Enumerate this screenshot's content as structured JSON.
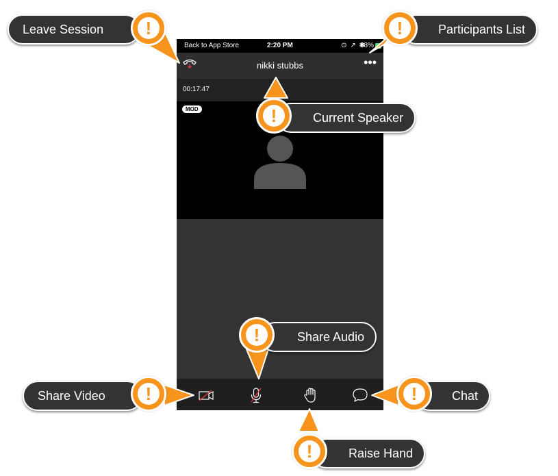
{
  "status_bar": {
    "back_label": "Back to App Store",
    "time": "2:20 PM",
    "indicators": "⊙ ↗ ✱",
    "battery": "38%",
    "battery_color": "#4cd964"
  },
  "nav": {
    "speaker_name": "nikki stubbs",
    "hangup_icon": "phone-hangup-icon",
    "more_icon": "more-dots-icon",
    "more_glyph": "•••"
  },
  "session": {
    "timer": "00:17:47",
    "moderator_badge": "MOD"
  },
  "toolbar": {
    "items": [
      {
        "icon": "video-off-icon"
      },
      {
        "icon": "mic-off-icon"
      },
      {
        "icon": "raise-hand-icon"
      },
      {
        "icon": "chat-bubble-icon"
      }
    ]
  },
  "callouts": {
    "leave_session": "Leave Session",
    "participants_list": "Participants List",
    "current_speaker": "Current Speaker",
    "share_audio": "Share Audio",
    "share_video": "Share Video",
    "chat": "Chat",
    "raise_hand": "Raise Hand",
    "badge_glyph": "!"
  },
  "colors": {
    "accent": "#f7941d",
    "callout_bg": "#333333",
    "muted_red": "#e53935"
  }
}
